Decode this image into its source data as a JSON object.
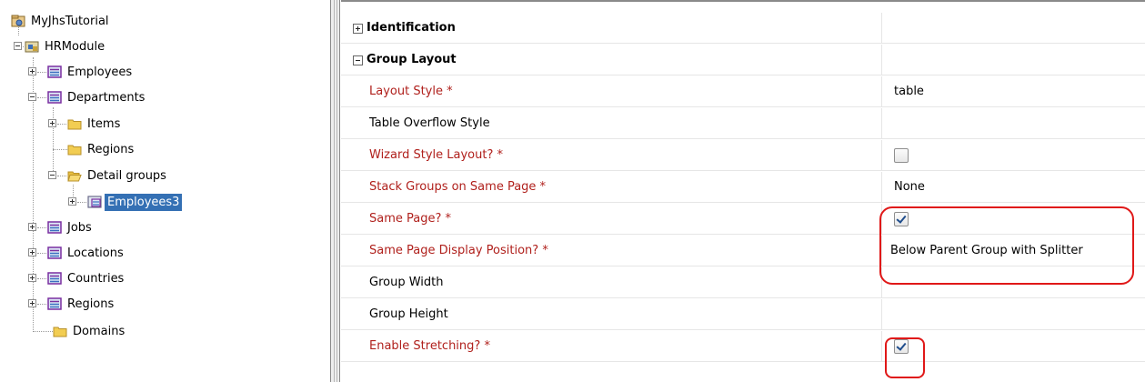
{
  "tree": {
    "project": "MyJhsTutorial",
    "module": "HRModule",
    "groups": {
      "employees": "Employees",
      "departments": "Departments",
      "items": "Items",
      "regions_sub": "Regions",
      "detail_groups": "Detail groups",
      "employees3": "Employees3",
      "jobs": "Jobs",
      "locations": "Locations",
      "countries": "Countries",
      "regions": "Regions",
      "domains": "Domains"
    },
    "selected": "Employees3"
  },
  "props": {
    "identification": {
      "label": "Identification",
      "state": "collapsed"
    },
    "group_layout": {
      "label": "Group Layout",
      "state": "expanded"
    },
    "rows": {
      "layout_style": {
        "label": "Layout Style *",
        "value": "table"
      },
      "table_overflow_style": {
        "label": "Table Overflow Style",
        "value": ""
      },
      "wizard_style_layout": {
        "label": "Wizard Style Layout? *",
        "checked": false
      },
      "stack_groups": {
        "label": "Stack Groups on Same Page *",
        "value": "None"
      },
      "same_page": {
        "label": "Same Page? *",
        "checked": true
      },
      "same_page_display_position": {
        "label": "Same Page Display Position? *",
        "value": "Below Parent Group with Splitter"
      },
      "group_width": {
        "label": "Group Width",
        "value": ""
      },
      "group_height": {
        "label": "Group Height",
        "value": ""
      },
      "enable_stretching": {
        "label": "Enable Stretching? *",
        "checked": true
      }
    }
  },
  "colors": {
    "required_label": "#b0201c",
    "selection": "#3470b4",
    "highlight_marker": "#e01818",
    "group_icon": "#7a2fa0",
    "folder_icon": "#f2cd52"
  }
}
